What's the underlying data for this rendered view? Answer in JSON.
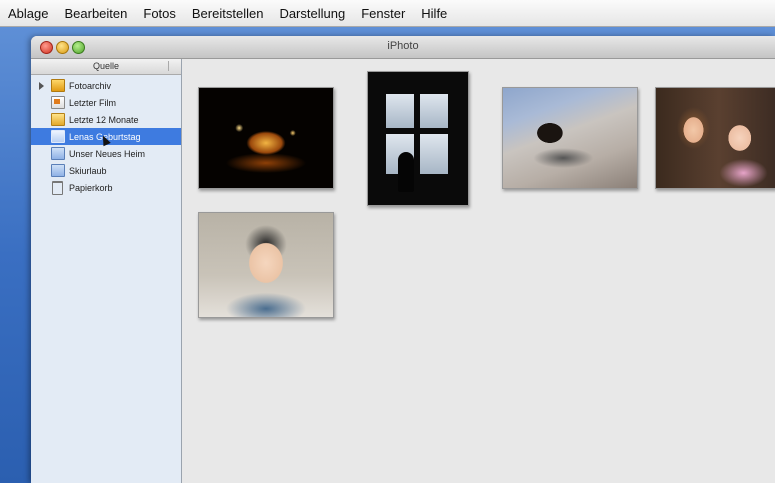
{
  "menubar": {
    "items": [
      "Ablage",
      "Bearbeiten",
      "Fotos",
      "Bereitstellen",
      "Darstellung",
      "Fenster",
      "Hilfe"
    ]
  },
  "window": {
    "title": "iPhoto"
  },
  "sidebar": {
    "header": "Quelle",
    "items": [
      {
        "label": "Fotoarchiv",
        "icon": "photo-library-icon",
        "selected": false
      },
      {
        "label": "Letzter Film",
        "icon": "film-roll-icon",
        "selected": false
      },
      {
        "label": "Letzte 12 Monate",
        "icon": "calendar-icon",
        "selected": false
      },
      {
        "label": "Lenas Geburtstag",
        "icon": "album-icon",
        "selected": true
      },
      {
        "label": "Unser Neues Heim",
        "icon": "album-icon",
        "selected": false
      },
      {
        "label": "Skiurlaub",
        "icon": "album-icon",
        "selected": false
      },
      {
        "label": "Papierkorb",
        "icon": "trash-icon",
        "selected": false
      }
    ]
  },
  "photos": [
    {
      "name": "night-lights-photo"
    },
    {
      "name": "window-silhouette-photo"
    },
    {
      "name": "dog-on-blanket-photo"
    },
    {
      "name": "two-children-photo"
    },
    {
      "name": "baby-portrait-photo"
    }
  ],
  "colors": {
    "selection": "#3e7be0",
    "sidebar_bg": "#e3ebf5",
    "desktop": "#3a6fc2"
  }
}
